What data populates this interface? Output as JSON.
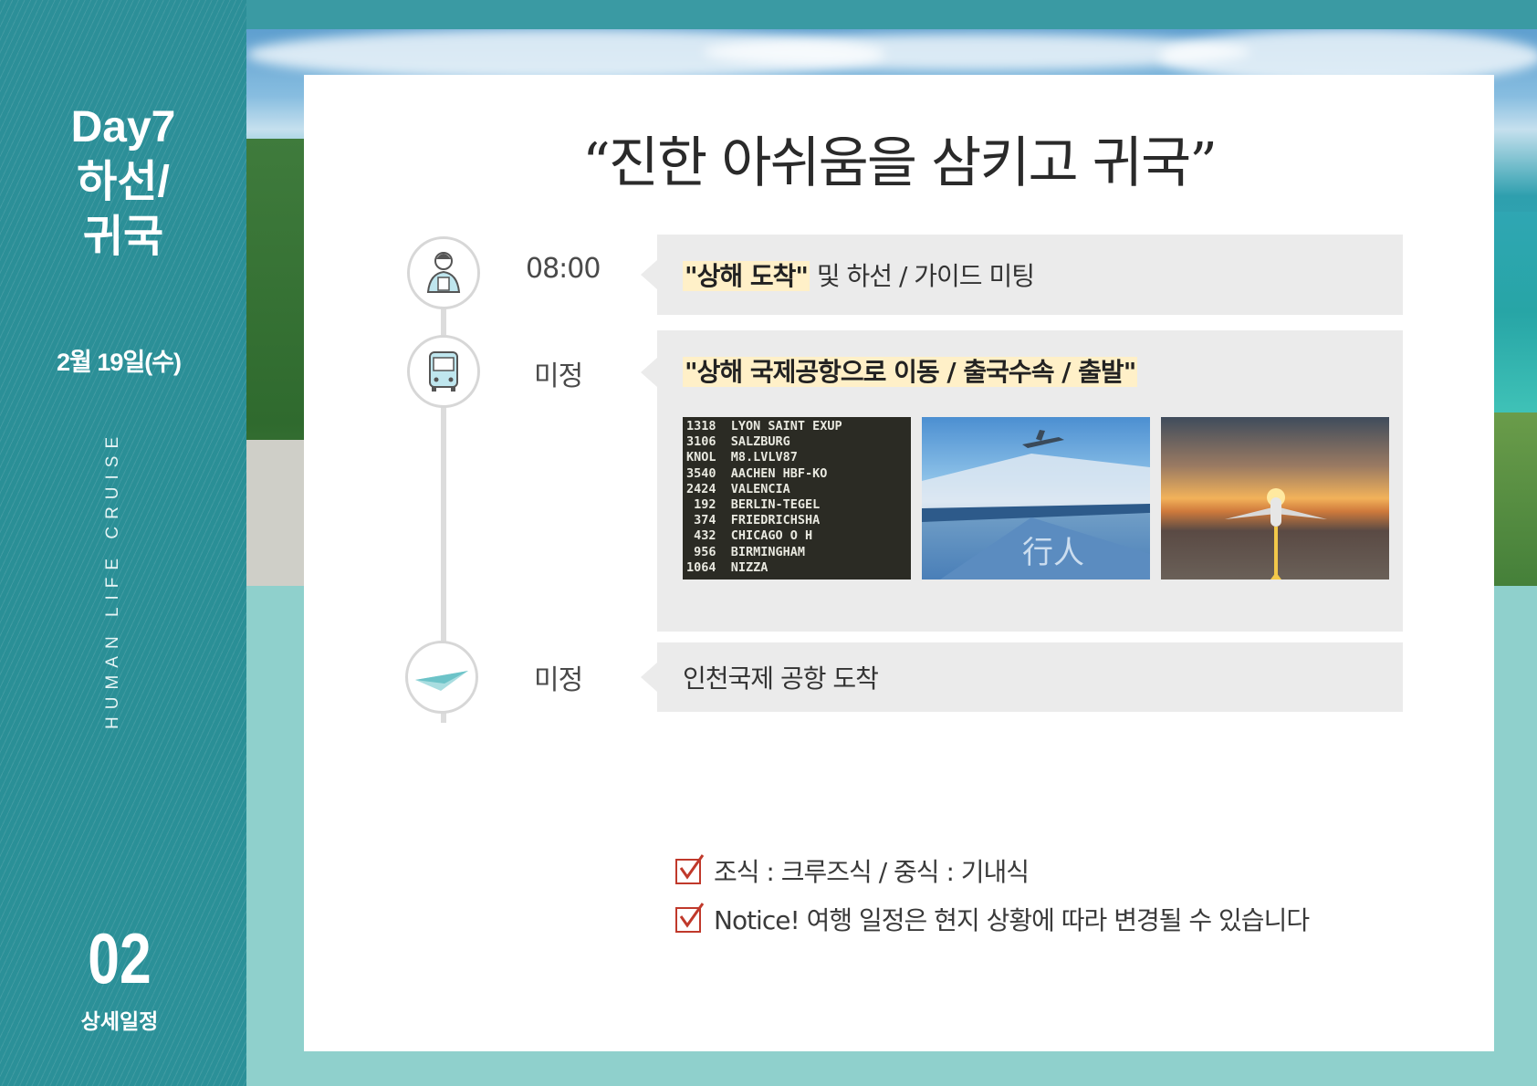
{
  "sidebar": {
    "day_line1": "Day7",
    "day_line2": "하선/",
    "day_line3": "귀국",
    "date": "2월 19일(수)",
    "brand_vertical": "HUMAN LIFE CRUISE",
    "page_number": "02",
    "page_label": "상세일정"
  },
  "card": {
    "title": "“진한 아쉬움을 삼키고 귀국”",
    "timeline": [
      {
        "icon": "guide-person-icon",
        "time": "08:00",
        "highlight": "\"상해 도착\"",
        "text": " 및 하선 / 가이드 미팅"
      },
      {
        "icon": "bus-icon",
        "time": "미정",
        "highlight": "\"상해 국제공항으로 이동 / 출국수속 / 출발\"",
        "text": "",
        "photos": {
          "board_lines": [
            "1318  LYON SAINT EXUP",
            "3106  SALZBURG",
            "KNOL  M8.LVLV87",
            "3540  AACHEN HBF-KO",
            "2424  VALENCIA",
            " 192  BERLIN-TEGEL",
            " 374  FRIEDRICHSHA",
            " 432  CHICAGO O H",
            " 956  BIRMINGHAM",
            "1064  NIZZA"
          ],
          "terminal_sign": "行人",
          "photo3": "airplane-runway-sunset-photo"
        }
      },
      {
        "icon": "paper-plane-icon",
        "time": "미정",
        "highlight": "",
        "text": "인천국제 공항 도착"
      }
    ],
    "notes": [
      "조식 : 크루즈식   /   중식 : 기내식",
      "Notice!  여행 일정은 현지 상황에 따라 변경될 수 있습니다"
    ]
  },
  "colors": {
    "sidebar_teal": "#2c8f98",
    "highlight_bg": "#fff0c8",
    "check_red": "#c0392b",
    "box_gray": "#ebebeb"
  }
}
